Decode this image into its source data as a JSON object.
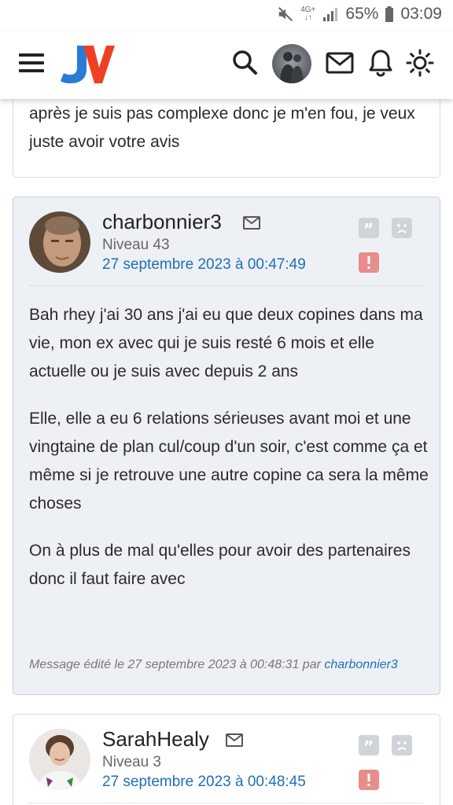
{
  "status_bar": {
    "network_top": "4G+",
    "battery": "65%",
    "time": "03:09"
  },
  "header": {
    "logo_text": "JV",
    "icons": [
      "menu-icon",
      "search-icon",
      "avatar",
      "mail-icon",
      "bell-icon",
      "sun-icon"
    ]
  },
  "previous_post": {
    "text": "après je suis pas complexe donc je m'en fou, je veux juste avoir votre avis"
  },
  "post1": {
    "author": "charbonnier3",
    "level": "Niveau 43",
    "date": "27 septembre 2023 à 00:47:49",
    "paragraphs": [
      "Bah rhey j'ai 30 ans j'ai eu que deux copines dans ma vie, mon ex avec qui je suis resté 6 mois et elle actuelle ou je suis avec depuis 2 ans",
      "Elle, elle a eu 6 relations sérieuses avant moi et une vingtaine de plan cul/coup d'un soir, c'est comme ça et même si je retrouve une autre copine ca sera la même choses",
      "On à plus de mal qu'elles pour avoir des partenaires donc il faut faire avec"
    ],
    "edited_prefix": "Message édité le 27 septembre 2023 à 00:48:31 par",
    "edited_by": "charbonnier3"
  },
  "post2": {
    "author": "SarahHealy",
    "level": "Niveau 3",
    "date": "27 septembre 2023 à 00:48:45"
  },
  "colors": {
    "accent_blue": "#1e6fb8",
    "logo_red": "#ef4023",
    "logo_blue": "#2b7bd6",
    "highlight_bg": "#edf1f6",
    "alert_red": "#e88c8c"
  }
}
